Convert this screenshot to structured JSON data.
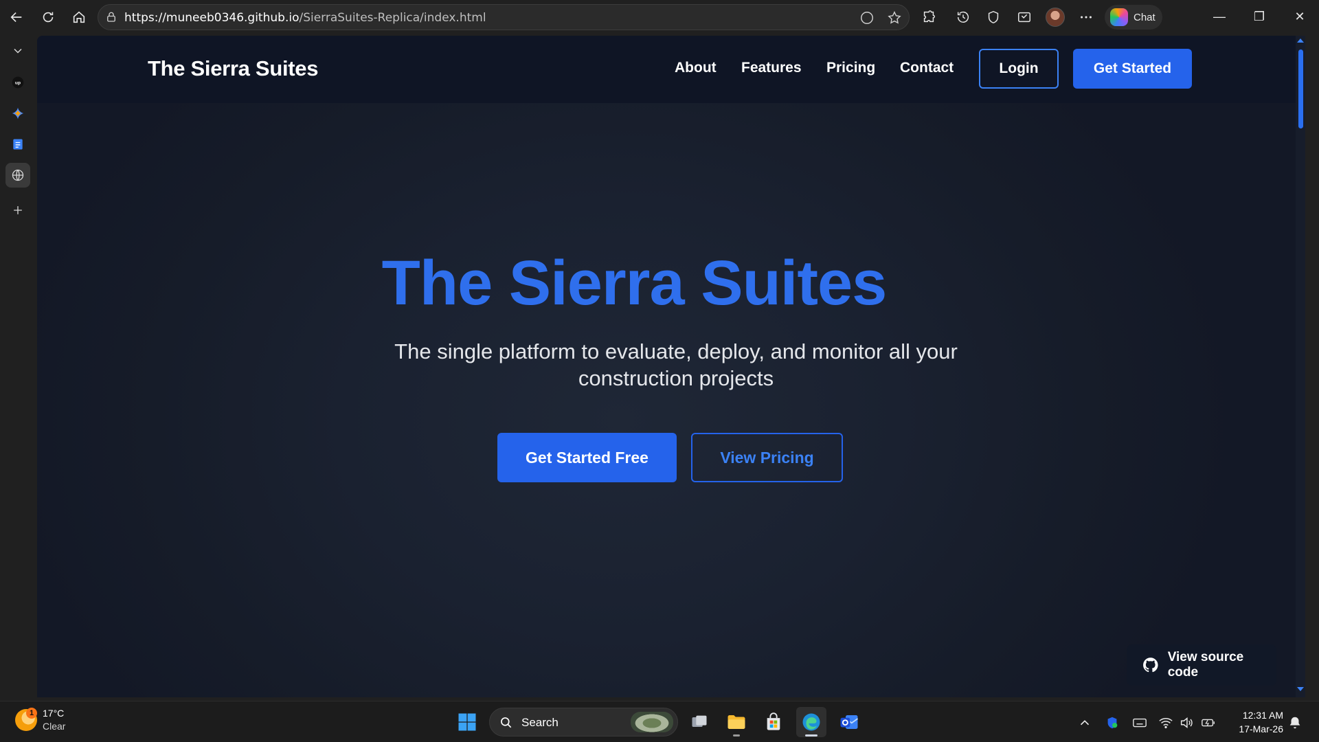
{
  "browser": {
    "url_host": "https://muneeb0346.github.io",
    "url_path": "/SierraSuites-Replica/index.html",
    "chat_label": "Chat"
  },
  "nav": {
    "brand": "The Sierra Suites",
    "links": [
      "About",
      "Features",
      "Pricing",
      "Contact"
    ],
    "login_label": "Login",
    "get_started_label": "Get Started"
  },
  "hero": {
    "title": "The Sierra Suites",
    "subtitle_line1": "The single platform to evaluate, deploy, and monitor all your",
    "subtitle_line2": "construction projects",
    "primary_cta": "Get Started Free",
    "secondary_cta": "View Pricing"
  },
  "source_button": {
    "label": "View source code"
  },
  "taskbar": {
    "weather_temp": "17°C",
    "weather_cond": "Clear",
    "weather_badge": "1",
    "search_label": "Search",
    "time": "12:31 AM",
    "date": "17-Mar-26"
  },
  "colors": {
    "accent": "#2563eb",
    "hero_title": "#2f6fed",
    "nav_bg": "#0f1525",
    "page_bg": "#1a2130"
  }
}
